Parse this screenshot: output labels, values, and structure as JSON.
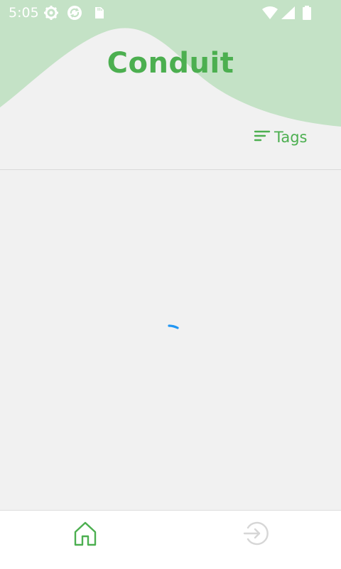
{
  "status_bar": {
    "time": "5:05",
    "left_icons": [
      "settings-gear-icon",
      "sync-icon",
      "sd-card-icon"
    ],
    "right_icons": [
      "wifi-icon",
      "cell-signal-icon",
      "battery-icon"
    ]
  },
  "header": {
    "title": "Conduit",
    "tags_button_label": "Tags",
    "tags_icon": "sort-lines-icon"
  },
  "main": {
    "loading": true
  },
  "bottom_nav": {
    "items": [
      {
        "icon": "home-icon",
        "active": true
      },
      {
        "icon": "login-icon",
        "active": false
      }
    ]
  },
  "colors": {
    "brand": "#4caf50",
    "status_bar_bg": "#c4e2c6",
    "background": "#f1f1f1",
    "spinner": "#2196f3",
    "inactive_icon": "#d6d6d6"
  }
}
